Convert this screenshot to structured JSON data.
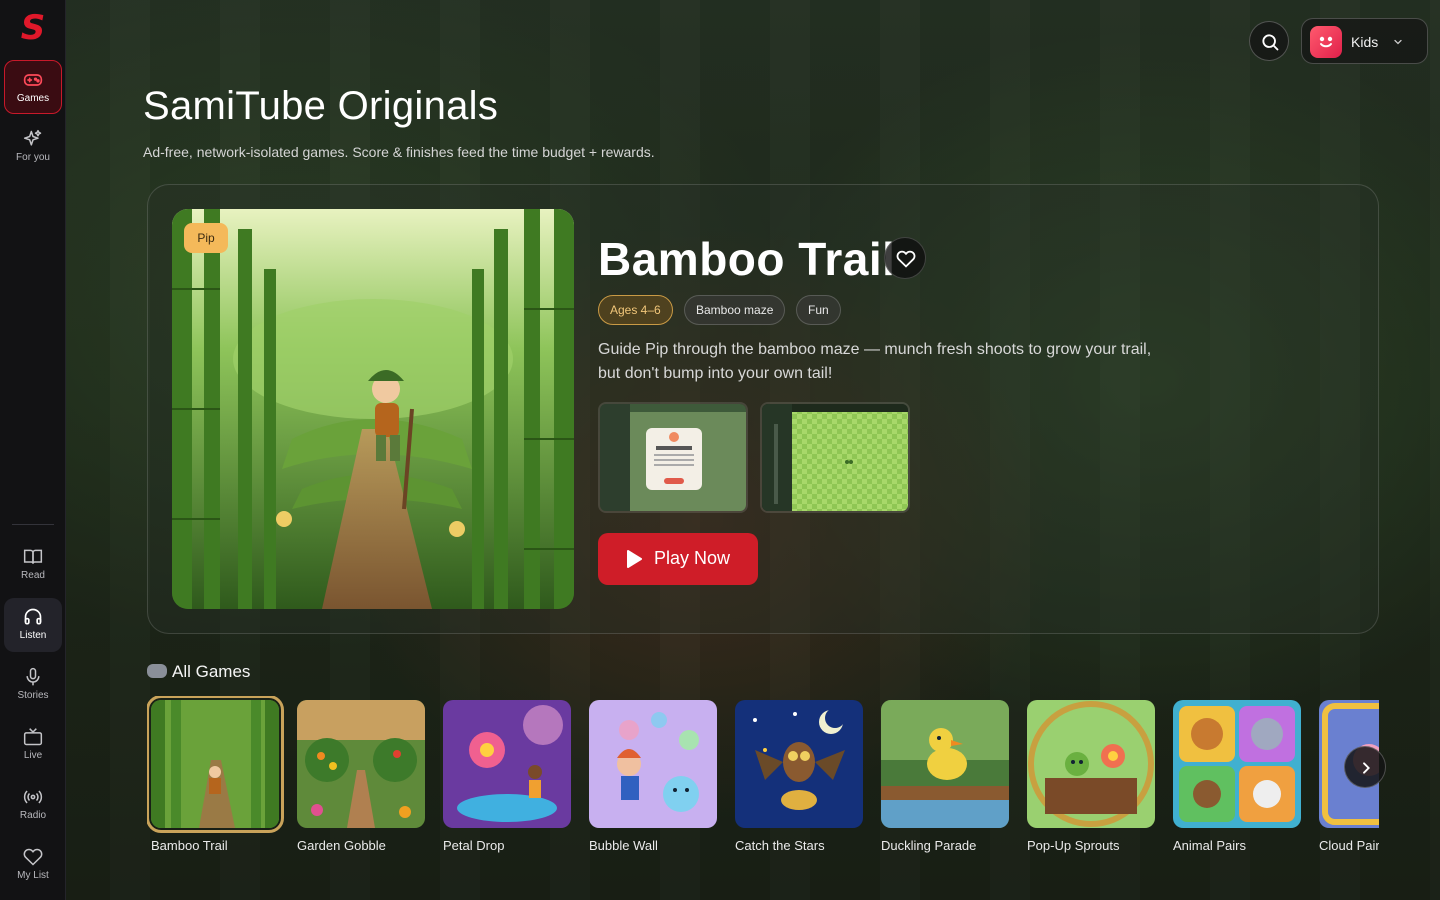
{
  "app": {
    "logo": "S"
  },
  "sidebar": {
    "items": [
      {
        "label": "Games",
        "icon": "gamepad-icon"
      },
      {
        "label": "For you",
        "icon": "sparkles-icon"
      },
      {
        "label": "Read",
        "icon": "book-icon"
      },
      {
        "label": "Listen",
        "icon": "headphones-icon"
      },
      {
        "label": "Stories",
        "icon": "microphone-icon"
      },
      {
        "label": "Live",
        "icon": "tv-icon"
      },
      {
        "label": "Radio",
        "icon": "radio-icon"
      },
      {
        "label": "My List",
        "icon": "heart-icon"
      }
    ]
  },
  "header": {
    "title": "SamiTube Originals",
    "subtitle": "Ad-free, network-isolated games. Score & finishes feed the time budget + rewards."
  },
  "profile": {
    "name": "Kids"
  },
  "hero": {
    "badge": "Pip",
    "title": "Bamboo Trail",
    "tags": [
      "Ages 4–6",
      "Bamboo maze",
      "Fun"
    ],
    "description": "Guide Pip through the bamboo maze — munch fresh shoots to grow your trail, but don't bump into your own tail!",
    "play_label": "Play Now"
  },
  "games": {
    "section_title": "All Games",
    "items": [
      {
        "title": "Bamboo Trail"
      },
      {
        "title": "Garden Gobble"
      },
      {
        "title": "Petal Drop"
      },
      {
        "title": "Bubble Wall"
      },
      {
        "title": "Catch the Stars"
      },
      {
        "title": "Duckling Parade"
      },
      {
        "title": "Pop-Up Sprouts"
      },
      {
        "title": "Animal Pairs"
      },
      {
        "title": "Cloud Pair"
      }
    ]
  },
  "colors": {
    "accent": "#cf1d28",
    "selected_border": "#c9a35a",
    "pip_badge": "#f4b95a"
  }
}
